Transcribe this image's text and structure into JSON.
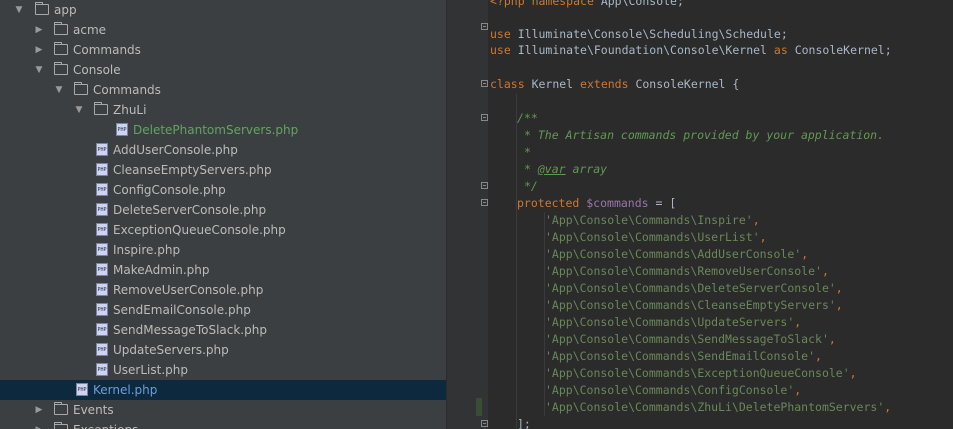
{
  "tree": {
    "items": [
      {
        "label": "app",
        "type": "folder",
        "expanded": true
      },
      {
        "label": "acme",
        "type": "folder",
        "expanded": false
      },
      {
        "label": "Commands",
        "type": "folder",
        "expanded": false
      },
      {
        "label": "Console",
        "type": "folder",
        "expanded": true
      },
      {
        "label": "Commands",
        "type": "folder",
        "expanded": true
      },
      {
        "label": "ZhuLi",
        "type": "folder",
        "expanded": true
      },
      {
        "label": "DeletePhantomServers.php",
        "type": "file",
        "status": "added"
      },
      {
        "label": "AddUserConsole.php",
        "type": "file"
      },
      {
        "label": "CleanseEmptyServers.php",
        "type": "file"
      },
      {
        "label": "ConfigConsole.php",
        "type": "file"
      },
      {
        "label": "DeleteServerConsole.php",
        "type": "file"
      },
      {
        "label": "ExceptionQueueConsole.php",
        "type": "file"
      },
      {
        "label": "Inspire.php",
        "type": "file"
      },
      {
        "label": "MakeAdmin.php",
        "type": "file"
      },
      {
        "label": "RemoveUserConsole.php",
        "type": "file"
      },
      {
        "label": "SendEmailConsole.php",
        "type": "file"
      },
      {
        "label": "SendMessageToSlack.php",
        "type": "file"
      },
      {
        "label": "UpdateServers.php",
        "type": "file"
      },
      {
        "label": "UserList.php",
        "type": "file"
      },
      {
        "label": "Kernel.php",
        "type": "file",
        "status": "modified",
        "selected": true
      },
      {
        "label": "Events",
        "type": "folder",
        "expanded": false
      },
      {
        "label": "Exceptions",
        "type": "folder",
        "expanded": false
      }
    ],
    "file_icon_text": "PHP"
  },
  "editor": {
    "open_tag": "<?php",
    "namespace_kw": "namespace",
    "namespace_name": "App\\Console;",
    "use_kw": "use",
    "use_1": "Illuminate\\Console\\Scheduling\\Schedule;",
    "use_2_path": "Illuminate\\Foundation\\Console\\Kernel",
    "as_kw": "as",
    "use_2_alias": "ConsoleKernel;",
    "class_kw": "class",
    "class_name": "Kernel",
    "extends_kw": "extends",
    "parent_class": "ConsoleKernel {",
    "doc_open": "/**",
    "doc_line": "* The Artisan commands provided by your application.",
    "doc_star": "*",
    "doc_tag_star": "* ",
    "doc_tag": "@var",
    "doc_tag_type": " array",
    "doc_close": "*/",
    "protected_kw": "protected",
    "var_name": "$commands",
    "assign": " = [",
    "commands": [
      "'App\\Console\\Commands\\Inspire'",
      "'App\\Console\\Commands\\UserList'",
      "'App\\Console\\Commands\\AddUserConsole'",
      "'App\\Console\\Commands\\RemoveUserConsole'",
      "'App\\Console\\Commands\\DeleteServerConsole'",
      "'App\\Console\\Commands\\CleanseEmptyServers'",
      "'App\\Console\\Commands\\UpdateServers'",
      "'App\\Console\\Commands\\SendMessageToSlack'",
      "'App\\Console\\Commands\\SendEmailConsole'",
      "'App\\Console\\Commands\\ExceptionQueueConsole'",
      "'App\\Console\\Commands\\ConfigConsole'",
      "'App\\Console\\Commands\\ZhuLi\\DeletePhantomServers'"
    ],
    "comma": ",",
    "array_close": "];"
  },
  "colors": {
    "tree_background": "#3c3f41",
    "selection": "#0d293e",
    "editor_background": "#2b2b2b",
    "keyword": "#cc7832",
    "string": "#6a8759",
    "doc_comment": "#629755",
    "variable": "#9876aa",
    "added_file": "#62a362",
    "modified_file": "#6f9dd8"
  }
}
